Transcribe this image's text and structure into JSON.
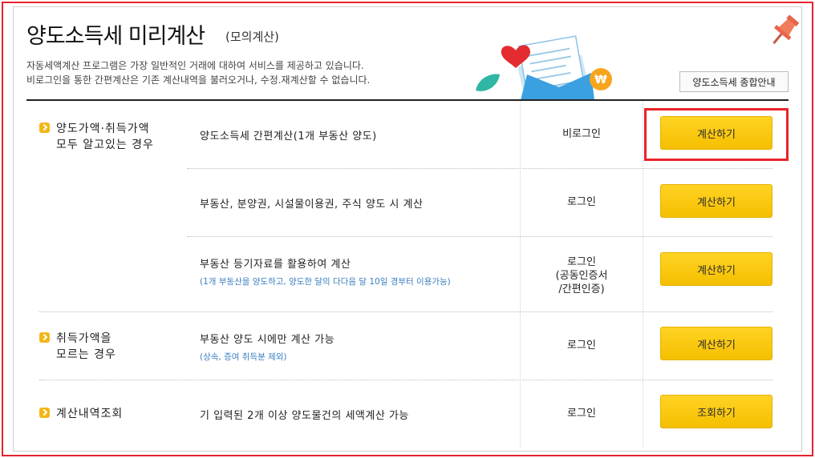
{
  "header": {
    "title": "양도소득세 미리계산",
    "subtitle": "(모의계산)",
    "desc_line1": "자동세액계산 프로그램은 가장 일반적인 거래에 대하여 서비스를 제공하고 있습니다.",
    "desc_line2": "비로그인을 통한 간편계산은 기존 계산내역을 불러오거나, 수정.재계산할 수 없습니다.",
    "guide_button": "양도소득세 종합안내"
  },
  "categories": [
    {
      "line1": "양도가액·취득가액",
      "line2": "모두 알고있는 경우"
    },
    {
      "line1": "취득가액을",
      "line2": "모르는 경우"
    },
    {
      "line1": "계산내역조회",
      "line2": ""
    }
  ],
  "rows": [
    {
      "title": "양도소득세 간편계산(1개 부동산 양도)",
      "note": "",
      "login_line1": "비로그인",
      "login_line2": "",
      "login_line3": "",
      "button": "계산하기"
    },
    {
      "title": "부동산, 분양권, 시설물이용권, 주식 양도 시 계산",
      "note": "",
      "login_line1": "로그인",
      "login_line2": "",
      "login_line3": "",
      "button": "계산하기"
    },
    {
      "title": "부동산 등기자료를 활용하여 계산",
      "note": "(1개 부동산을 양도하고, 양도한 달의 다다음 달 10일 경부터 이용가능)",
      "login_line1": "로그인",
      "login_line2": "(공동인증서",
      "login_line3": "/간편인증)",
      "button": "계산하기"
    },
    {
      "title": "부동산 양도 시에만 계산 가능",
      "note": "(상속, 증여 취득분 제외)",
      "login_line1": "로그인",
      "login_line2": "",
      "login_line3": "",
      "button": "계산하기"
    },
    {
      "title": "기 입력된 2개 이상 양도물건의 세액계산 가능",
      "note": "",
      "login_line1": "로그인",
      "login_line2": "",
      "login_line3": "",
      "button": "조회하기"
    }
  ],
  "colors": {
    "accent_yellow": "#f5bf00",
    "highlight_red": "#e8232a",
    "note_blue": "#3a7fc1"
  },
  "icons": [
    "pushpin-icon",
    "heart-icon",
    "envelope-icon",
    "leaf-icon",
    "won-coin-icon",
    "check-bullet-icon"
  ]
}
